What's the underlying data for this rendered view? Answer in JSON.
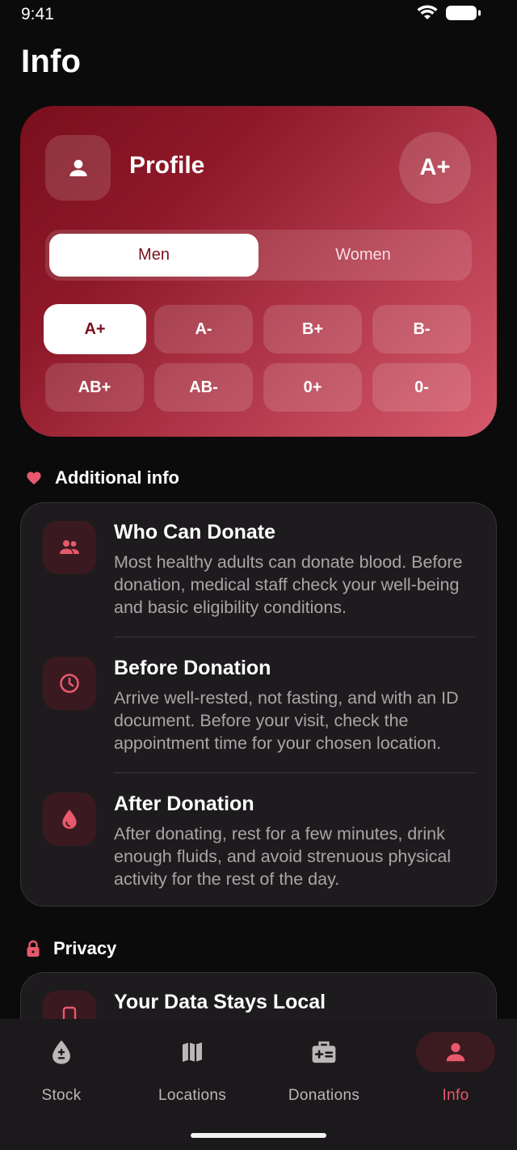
{
  "status": {
    "time": "9:41"
  },
  "page": {
    "title": "Info"
  },
  "profile": {
    "title": "Profile",
    "selected_blood_type": "A+",
    "gender": {
      "men": "Men",
      "women": "Women",
      "selected": "Men"
    },
    "blood_types": [
      "A+",
      "A-",
      "B+",
      "B-",
      "AB+",
      "AB-",
      "0+",
      "0-"
    ]
  },
  "additional": {
    "header": "Additional info",
    "items": [
      {
        "title": "Who Can Donate",
        "body": "Most healthy adults can donate blood. Before donation, medical staff check your well-being and basic eligibility conditions.",
        "icon": "people-icon"
      },
      {
        "title": "Before Donation",
        "body": "Arrive well-rested, not fasting, and with an ID document. Before your visit, check the appointment time for your chosen location.",
        "icon": "clock-icon"
      },
      {
        "title": "After Donation",
        "body": "After donating, rest for a few minutes, drink enough fluids, and avoid strenuous physical activity for the rest of the day.",
        "icon": "drop-icon"
      }
    ]
  },
  "privacy": {
    "header": "Privacy",
    "items": [
      {
        "title": "Your Data Stays Local",
        "icon": "phone-icon"
      }
    ]
  },
  "nav": {
    "items": [
      {
        "label": "Stock",
        "icon": "blood-drop-plus-minus-icon"
      },
      {
        "label": "Locations",
        "icon": "map-icon"
      },
      {
        "label": "Donations",
        "icon": "medical-kit-icon"
      },
      {
        "label": "Info",
        "icon": "person-icon",
        "active": true
      }
    ]
  },
  "colors": {
    "accent": "#e8596c",
    "card_grad_start": "#7a0f1d",
    "card_grad_end": "#d65a6b",
    "surface": "#1d1b1d"
  }
}
